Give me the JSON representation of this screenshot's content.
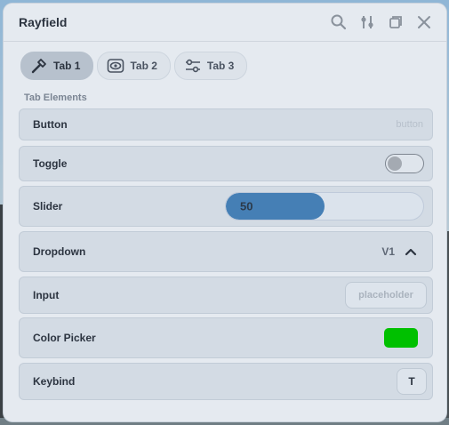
{
  "window": {
    "title": "Rayfield"
  },
  "titlebar_icons": [
    "search-icon",
    "sliders-icon",
    "restore-icon",
    "close-icon"
  ],
  "tabs": [
    {
      "label": "Tab 1",
      "icon": "hammer-icon",
      "active": true
    },
    {
      "label": "Tab 2",
      "icon": "eye-icon",
      "active": false
    },
    {
      "label": "Tab 3",
      "icon": "settings-sliders-icon",
      "active": false
    }
  ],
  "section": {
    "label": "Tab Elements"
  },
  "elements": {
    "button": {
      "label": "Button",
      "hint": "button"
    },
    "toggle": {
      "label": "Toggle",
      "value": false
    },
    "slider": {
      "label": "Slider",
      "value": "50",
      "fraction": 0.5,
      "fill_color": "#457fb5"
    },
    "dropdown": {
      "label": "Dropdown",
      "value": "V1",
      "expanded": true
    },
    "input": {
      "label": "Input",
      "value": "",
      "placeholder": "placeholder"
    },
    "color_picker": {
      "label": "Color Picker",
      "color": "#00c000"
    },
    "keybind": {
      "label": "Keybind",
      "value": "T"
    }
  }
}
